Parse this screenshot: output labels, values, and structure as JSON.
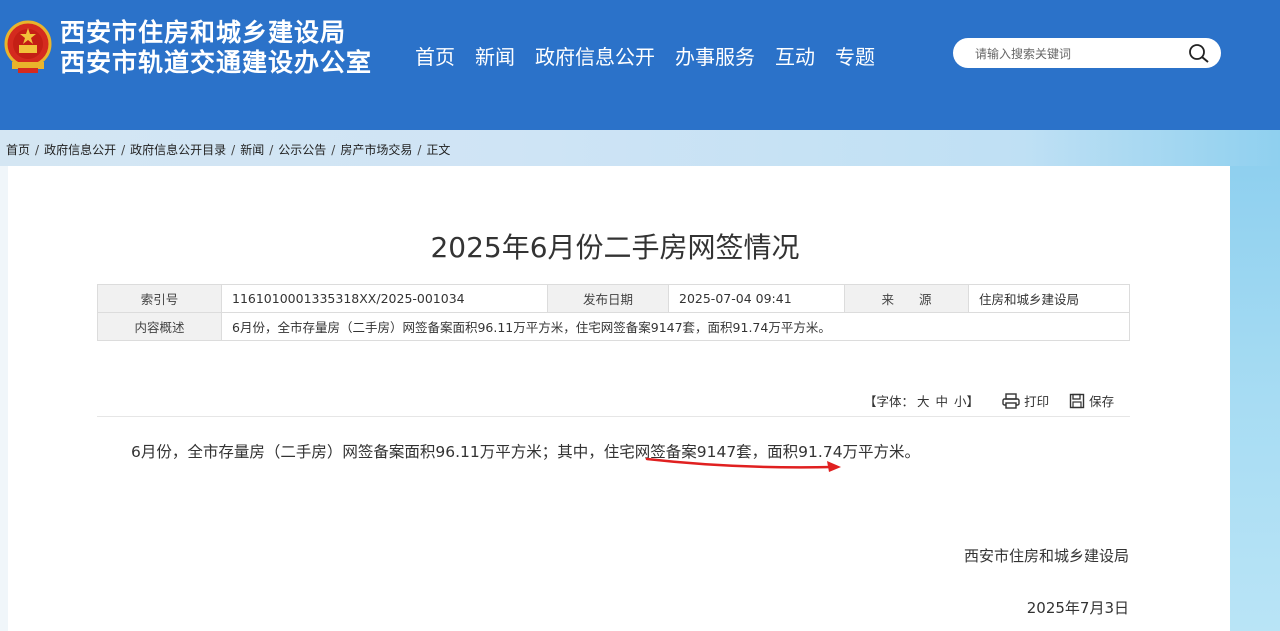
{
  "header": {
    "title_line1": "西安市住房和城乡建设局",
    "title_line2": "西安市轨道交通建设办公室",
    "nav": [
      "首页",
      "新闻",
      "政府信息公开",
      "办事服务",
      "互动",
      "专题"
    ],
    "search_placeholder": "请输入搜索关键词"
  },
  "breadcrumb": [
    "首页",
    "政府信息公开",
    "政府信息公开目录",
    "新闻",
    "公示公告",
    "房产市场交易",
    "正文"
  ],
  "article": {
    "title": "2025年6月份二手房网签情况",
    "meta": {
      "index_label": "索引号",
      "index_value": "1161010001335318XX/2025-001034",
      "date_label": "发布日期",
      "date_value": "2025-07-04 09:41",
      "source_label": "来　　源",
      "source_value": "住房和城乡建设局",
      "summary_label": "内容概述",
      "summary_value": "6月份，全市存量房（二手房）网签备案面积96.11万平方米，住宅网签备案9147套，面积91.74万平方米。"
    },
    "tools": {
      "font_label": "【字体：",
      "font_large": "大",
      "font_medium": "中",
      "font_small": "小】",
      "print": "打印",
      "save": "保存"
    },
    "body": "6月份，全市存量房（二手房）网签备案面积96.11万平方米；其中，住宅网签备案9147套，面积91.74万平方米。",
    "signature": "西安市住房和城乡建设局",
    "date": "2025年7月3日"
  },
  "colors": {
    "header_bg": "#2b72c9",
    "annotation_arrow": "#e02020"
  }
}
